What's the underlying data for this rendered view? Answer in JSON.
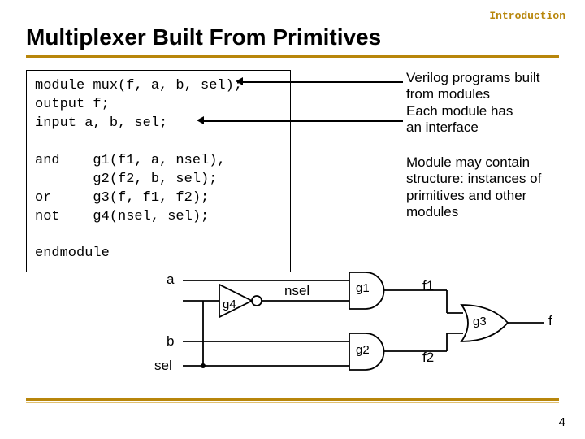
{
  "header": {
    "section": "Introduction"
  },
  "title": "Multiplexer Built From Primitives",
  "code": {
    "l1": "module mux(f, a, b, sel);",
    "l2": "output f;",
    "l3": "input a, b, sel;",
    "l4": "",
    "l5": "and    g1(f1, a, nsel),",
    "l6": "       g2(f2, b, sel);",
    "l7": "or     g3(f, f1, f2);",
    "l8": "not    g4(nsel, sel);",
    "l9": "",
    "l10": "endmodule"
  },
  "annotations": {
    "a1_l1": "Verilog programs built",
    "a1_l2": "from modules",
    "a2_l1": "Each module has",
    "a2_l2": "an interface",
    "a3_l1": "Module may contain",
    "a3_l2": "structure: instances of",
    "a3_l3": "primitives and other",
    "a3_l4": "modules"
  },
  "diagram": {
    "a": "a",
    "b": "b",
    "sel": "sel",
    "nsel": "nsel",
    "g1": "g1",
    "g2": "g2",
    "g3": "g3",
    "g4": "g4",
    "f1": "f1",
    "f2": "f2",
    "f": "f"
  },
  "page": "4"
}
